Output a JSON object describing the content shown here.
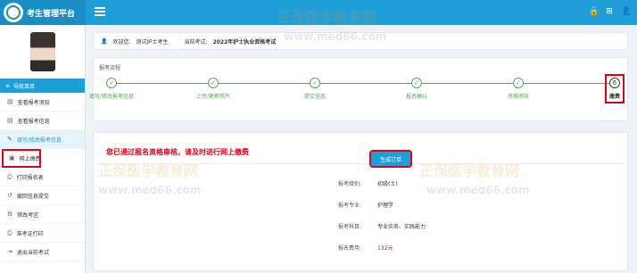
{
  "app": {
    "title": "考生管理平台"
  },
  "top_icons": [
    "lock-icon",
    "grid-icon",
    "user-icon"
  ],
  "sidebar": {
    "nav_header": "导航菜单",
    "items": [
      {
        "label": "查看报考须知",
        "icon": "document-icon"
      },
      {
        "label": "查看报考信息",
        "icon": "document-icon"
      },
      {
        "label": "填写/修改报考信息",
        "icon": "edit-icon",
        "active": true
      },
      {
        "label": "网上缴费",
        "icon": "payment-icon",
        "highlighted": true
      },
      {
        "label": "打印报名表",
        "icon": "print-icon"
      },
      {
        "label": "撤回信息提交",
        "icon": "undo-icon"
      },
      {
        "label": "修改考区",
        "icon": "settings-icon"
      },
      {
        "label": "准考证打印",
        "icon": "print-icon"
      },
      {
        "label": "退出当前考试",
        "icon": "exit-icon"
      }
    ]
  },
  "info_bar": {
    "welcome_label": "欢迎您:",
    "user_name": "测试护士考生",
    "current_exam_label": "当前考试:",
    "current_exam": "2022年护士执业资格考试"
  },
  "process": {
    "title": "报考流程",
    "steps": [
      {
        "label": "填写/修改报考信息",
        "done": true
      },
      {
        "label": "上传/更新照片",
        "done": true
      },
      {
        "label": "提交信息",
        "done": true
      },
      {
        "label": "报名确认",
        "done": true
      },
      {
        "label": "资格审核",
        "done": true
      },
      {
        "label": "缴费",
        "number": "6",
        "current": true
      }
    ]
  },
  "payment": {
    "notice": "您已通过报名资格审核，请及时进行网上缴费",
    "fields": [
      {
        "label": "报考级别:",
        "value": "初级(士)"
      },
      {
        "label": "报考专业:",
        "value": "护理学"
      },
      {
        "label": "报考科目:",
        "value": "专业实务、实践能力"
      },
      {
        "label": "报名费用:",
        "value": "132元",
        "red": true
      }
    ],
    "button_label": "生成订单"
  },
  "watermarks": {
    "brand": "正保医学教育网",
    "url": "www.med66.com"
  },
  "colors": {
    "primary": "#1f9fd8",
    "success": "#4caf50",
    "alert": "#e0001b"
  }
}
